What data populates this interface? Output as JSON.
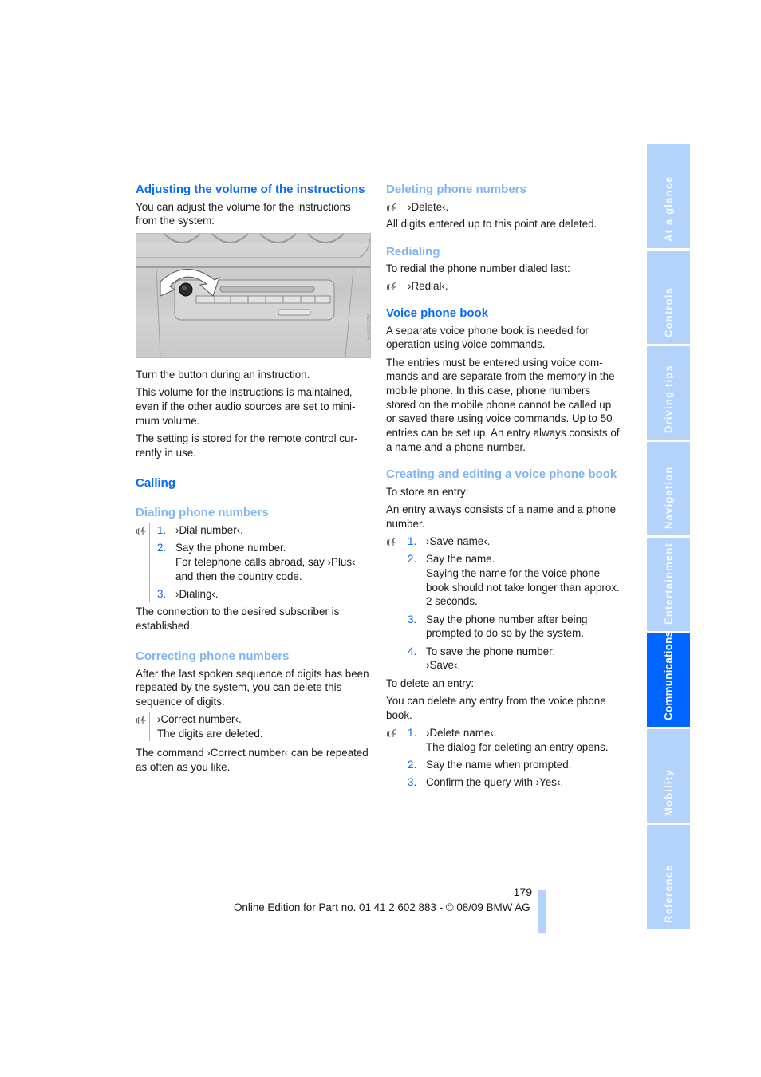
{
  "left_column": {
    "volume_heading": "Adjusting the volume of the instructions",
    "volume_intro": "You can adjust the volume for the instructions from the system:",
    "figure_alt": "dashboard-volume-knob-illustration",
    "figure_code": "W2C39WYA",
    "volume_p1": "Turn the button during an instruction.",
    "volume_p2": "This volume for the instructions is maintained, even if the other audio sources are set to mini-mum volume.",
    "volume_p3": "The setting is stored for the remote control cur-rently in use.",
    "calling_heading": "Calling",
    "dialing_heading": "Dialing phone numbers",
    "dialing_steps": [
      {
        "num": "1.",
        "text": "›Dial number‹."
      },
      {
        "num": "2.",
        "text": "Say the phone number.",
        "note": "For telephone calls abroad, say ›Plus‹ and then the country code."
      },
      {
        "num": "3.",
        "text": "›Dialing‹."
      }
    ],
    "dialing_result": "The connection to the desired subscriber is established.",
    "correcting_heading": "Correcting phone numbers",
    "correcting_intro": "After the last spoken sequence of digits has been repeated by the system, you can delete this sequence of digits.",
    "correcting_command": "›Correct number‹.",
    "correcting_command_note": "The digits are deleted.",
    "correcting_outro": "The command ›Correct number‹ can be repeated as often as you like."
  },
  "right_column": {
    "deleting_heading": "Deleting phone numbers",
    "deleting_command": "›Delete‹.",
    "deleting_note": "All digits entered up to this point are deleted.",
    "redialing_heading": "Redialing",
    "redialing_intro": "To redial the phone number dialed last:",
    "redialing_command": "›Redial‹.",
    "phonebook_heading": "Voice phone book",
    "phonebook_p1": "A separate voice phone book is needed for operation using voice commands.",
    "phonebook_p2": "The entries must be entered using voice com-mands and are separate from the memory in the mobile phone. In this case, phone numbers stored on the mobile phone cannot be called up or saved there using voice commands. Up to 50 entries can be set up. An entry always consists of a name and a phone number.",
    "creating_heading": "Creating and editing a voice phone book",
    "store_intro": "To store an entry:",
    "store_note": "An entry always consists of a name and a phone number.",
    "store_steps": [
      {
        "num": "1.",
        "text": "›Save name‹."
      },
      {
        "num": "2.",
        "text": "Say the name.",
        "note": "Saying the name for the voice phone book should not take longer than approx. 2 seconds."
      },
      {
        "num": "3.",
        "text": "Say the phone number after being prompted to do so by the system."
      },
      {
        "num": "4.",
        "text": "To save the phone number:",
        "note": "›Save‹."
      }
    ],
    "delete_intro": "To delete an entry:",
    "delete_note": "You can delete any entry from the voice phone book.",
    "delete_steps": [
      {
        "num": "1.",
        "text": "›Delete name‹.",
        "note": "The dialog for deleting an entry opens."
      },
      {
        "num": "2.",
        "text": "Say the name when prompted."
      },
      {
        "num": "3.",
        "text": "Confirm the query with ›Yes‹."
      }
    ]
  },
  "sidebar": {
    "active_index": 5,
    "active_color": "#0066ff",
    "inactive_color": "#b3d3fb",
    "tabs": [
      {
        "label": "At a glance"
      },
      {
        "label": "Controls"
      },
      {
        "label": "Driving tips"
      },
      {
        "label": "Navigation"
      },
      {
        "label": "Entertainment"
      },
      {
        "label": "Communications"
      },
      {
        "label": "Mobility"
      },
      {
        "label": "Reference"
      }
    ]
  },
  "footer": {
    "page_number": "179",
    "edition": "Online Edition for Part no. 01 41 2 602 883 - © 08/09 BMW AG"
  },
  "colors": {
    "heading_main": "#0a6cf0",
    "heading_sub": "#7fb4f5",
    "text": "#1a1a1a"
  }
}
